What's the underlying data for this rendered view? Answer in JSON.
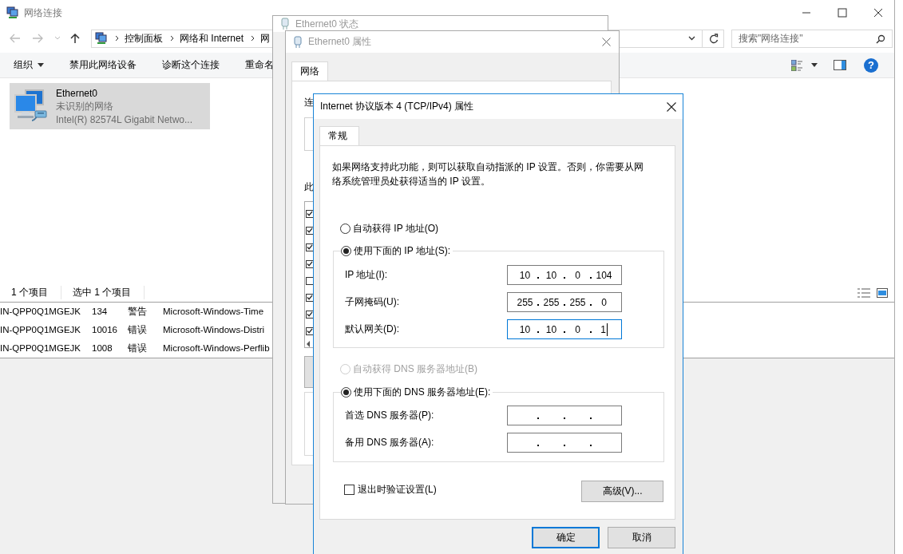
{
  "explorer": {
    "title": "网络连接",
    "breadcrumb": [
      "控制面板",
      "网络和 Internet",
      "网"
    ],
    "search": {
      "placeholder": "搜索\"网络连接\""
    },
    "toolbar": [
      {
        "label": "组织",
        "dropdown": true
      },
      {
        "label": "禁用此网络设备",
        "dropdown": false
      },
      {
        "label": "诊断这个连接",
        "dropdown": false
      },
      {
        "label": "重命名",
        "dropdown": false
      }
    ],
    "help_glyph": "?",
    "items": [
      {
        "name": "Ethernet0",
        "status": "未识别的网络",
        "device": "Intel(R) 82574L Gigabit Netwo...",
        "selected": true
      }
    ],
    "status_bar": [
      "1 个项目",
      "选中 1 个项目"
    ]
  },
  "event_rows": [
    {
      "column_1": "IN-QPP0Q1MGEJK",
      "column_2": "134",
      "column_3": "警告",
      "column_4": "Microsoft-Windows-Time"
    },
    {
      "column_1": "IN-QPP0Q1MGEJK",
      "column_2": "10016",
      "column_3": "错误",
      "column_4": "Microsoft-Windows-Distri"
    },
    {
      "column_1": "IN-QPP0Q1MGEJK",
      "column_2": "1008",
      "column_3": "错误",
      "column_4": "Microsoft-Windows-Perflib"
    }
  ],
  "status_dialog": {
    "title": "Ethernet0 状态"
  },
  "properties_dialog": {
    "title": "Ethernet0 属性",
    "tabs": [
      {
        "label": "网络",
        "selected": true
      }
    ],
    "label_1": "连",
    "label_2": "此",
    "components": [
      {
        "checked": true
      },
      {
        "checked": true
      },
      {
        "checked": true
      },
      {
        "checked": true
      },
      {
        "checked": false
      },
      {
        "checked": true
      },
      {
        "checked": true
      },
      {
        "checked": true
      }
    ]
  },
  "ipv4_dialog": {
    "title": "Internet 协议版本 4 (TCP/IPv4) 属性",
    "tabs": [
      {
        "label": "常规",
        "selected": true
      }
    ],
    "description": "如果网络支持此功能，则可以获取自动指派的 IP 设置。否则，你需要从网络系统管理员处获得适当的 IP 设置。",
    "ip_mode": [
      {
        "label": "自动获得 IP 地址(O)",
        "selected": false,
        "disabled": false
      },
      {
        "label": "使用下面的 IP 地址(S):",
        "selected": true,
        "disabled": false
      }
    ],
    "ip_fields": [
      {
        "label": "IP 地址(I):",
        "octets": [
          "10",
          "10",
          "0",
          "104"
        ],
        "focused": false
      },
      {
        "label": "子网掩码(U):",
        "octets": [
          "255",
          "255",
          "255",
          "0"
        ],
        "focused": false
      },
      {
        "label": "默认网关(D):",
        "octets": [
          "10",
          "10",
          "0",
          "1"
        ],
        "focused": true
      }
    ],
    "dns_mode": [
      {
        "label": "自动获得 DNS 服务器地址(B)",
        "selected": false,
        "disabled": true
      },
      {
        "label": "使用下面的 DNS 服务器地址(E):",
        "selected": true,
        "disabled": false
      }
    ],
    "dns_fields": [
      {
        "label": "首选 DNS 服务器(P):",
        "focused": false
      },
      {
        "label": "备用 DNS 服务器(A):",
        "focused": false
      }
    ],
    "validate_on_exit": {
      "label": "退出时验证设置(L)",
      "checked": false
    },
    "advanced_button": "高级(V)...",
    "buttons": [
      {
        "label": "确定",
        "default": true
      },
      {
        "label": "取消",
        "default": false
      }
    ]
  }
}
